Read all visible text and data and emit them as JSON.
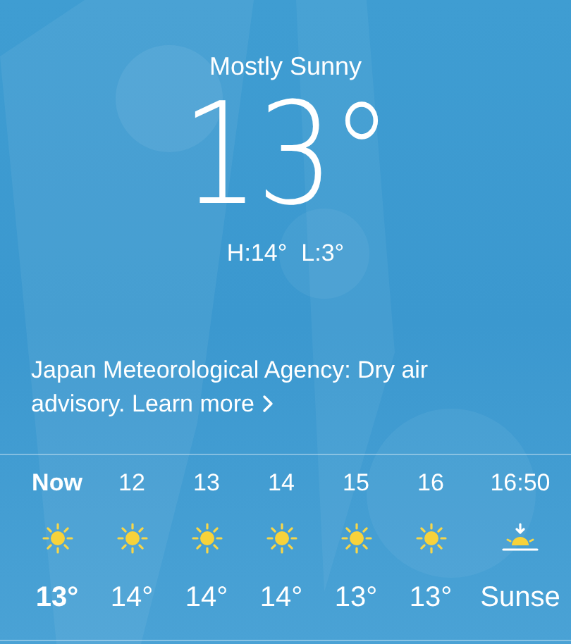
{
  "current": {
    "condition": "Mostly Sunny",
    "temperature": "13°",
    "high": "H:14°",
    "low": "L:3°"
  },
  "alert": {
    "text": "Japan Meteorological Agency: Dry air advisory.",
    "link": "Learn more"
  },
  "hourly": [
    {
      "time": "Now",
      "kind": "sun",
      "value": "13°",
      "current": true
    },
    {
      "time": "12",
      "kind": "sun",
      "value": "14°",
      "current": false
    },
    {
      "time": "13",
      "kind": "sun",
      "value": "14°",
      "current": false
    },
    {
      "time": "14",
      "kind": "sun",
      "value": "14°",
      "current": false
    },
    {
      "time": "15",
      "kind": "sun",
      "value": "13°",
      "current": false
    },
    {
      "time": "16",
      "kind": "sun",
      "value": "13°",
      "current": false
    },
    {
      "time": "16:50",
      "kind": "sunset",
      "value": "Sunse",
      "current": false
    }
  ]
}
